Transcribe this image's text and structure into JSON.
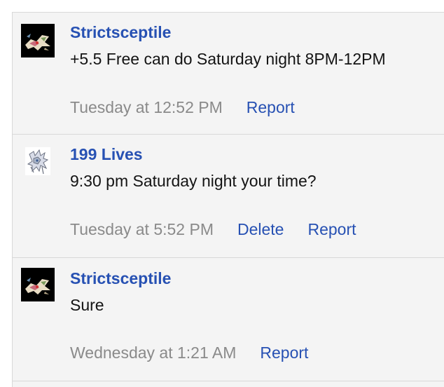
{
  "comments": [
    {
      "author": "Strictsceptile",
      "avatar": "sceptile-avatar",
      "text": "+5.5 Free can do Saturday night 8PM-12PM",
      "time": "Tuesday at 12:52 PM",
      "actions": [
        "Report"
      ]
    },
    {
      "author": "199 Lives",
      "avatar": "arceus-avatar",
      "text": "9:30 pm Saturday night your time?",
      "time": "Tuesday at 5:52 PM",
      "actions": [
        "Delete",
        "Report"
      ]
    },
    {
      "author": "Strictsceptile",
      "avatar": "sceptile-avatar",
      "text": "Sure",
      "time": "Wednesday at 1:21 AM",
      "actions": [
        "Report"
      ]
    }
  ],
  "colors": {
    "link": "#2751b3",
    "timestamp": "#8a8a8a",
    "background": "#f4f4f4",
    "border": "#d8d8d8"
  }
}
